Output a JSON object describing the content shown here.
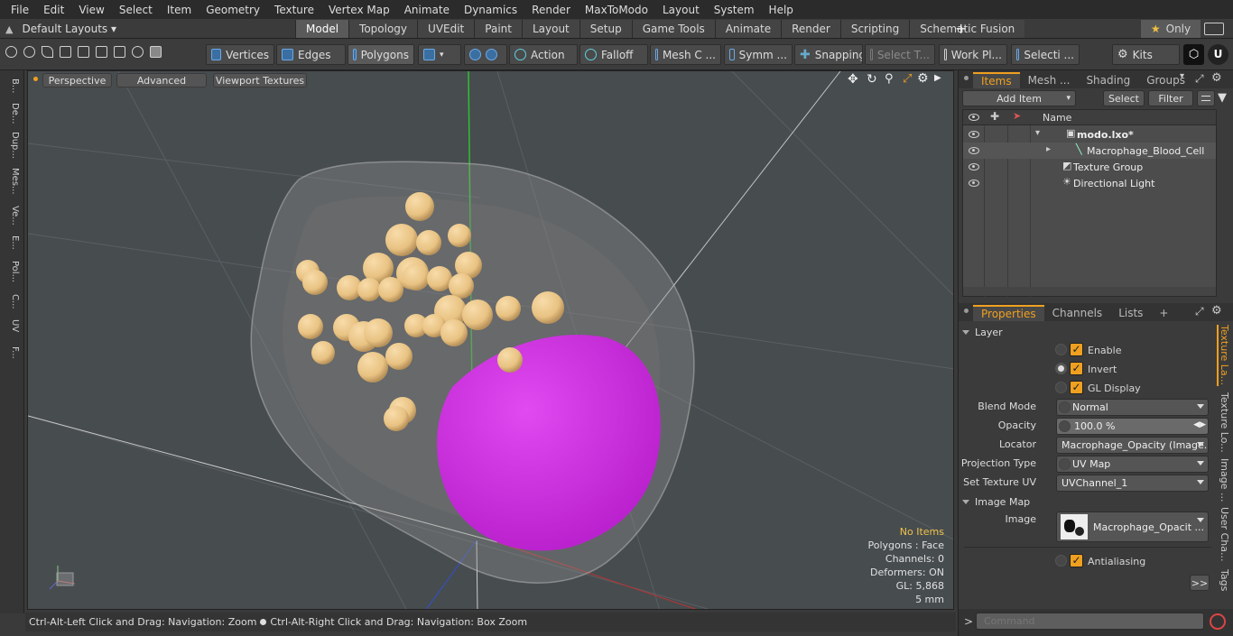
{
  "menu": [
    "File",
    "Edit",
    "View",
    "Select",
    "Item",
    "Geometry",
    "Texture",
    "Vertex Map",
    "Animate",
    "Dynamics",
    "Render",
    "MaxToModo",
    "Layout",
    "System",
    "Help"
  ],
  "layouts_label": "Default Layouts",
  "tabs": [
    "Model",
    "Topology",
    "UVEdit",
    "Paint",
    "Layout",
    "Setup",
    "Game Tools",
    "Animate",
    "Render",
    "Scripting",
    "Schematic Fusion"
  ],
  "tab_add": "+",
  "only_label": "Only",
  "toolbar": {
    "vertices": "Vertices",
    "edges": "Edges",
    "polygons": "Polygons",
    "action": "Action",
    "falloff": "Falloff",
    "mesh": "Mesh C ...",
    "symm": "Symm ...",
    "snapping": "Snapping",
    "select_t": "Select T...",
    "work_plane": "Work Pl...",
    "selecti": "Selecti ...",
    "kits": "Kits"
  },
  "left_tabs": [
    "B...",
    "De...",
    "Dup...",
    "Mes...",
    "Ve...",
    "E...",
    "Pol...",
    "C...",
    "UV",
    "F..."
  ],
  "viewport": {
    "perspective": "Perspective",
    "advanced": "Advanced",
    "viewport_textures": "Viewport Textures",
    "hud": {
      "no_items": "No Items",
      "polygons": "Polygons : Face",
      "channels": "Channels: 0",
      "deformers": "Deformers: ON",
      "gl": "GL: 5,868",
      "units": "5 mm"
    },
    "colors": {
      "nucleus": "#d42ee8",
      "granules": "#e8c282",
      "membrane": "#9a9a9a",
      "background": "#474c4f"
    }
  },
  "status": {
    "left": "Ctrl-Alt-Left Click and Drag: Navigation: Zoom",
    "right": "Ctrl-Alt-Right Click and Drag: Navigation: Box Zoom"
  },
  "items_panel": {
    "tabs": [
      "Items",
      "Mesh ...",
      "Shading",
      "Groups"
    ],
    "add_item": "Add Item",
    "select": "Select",
    "filter": "Filter",
    "col_name": "Name",
    "tree": [
      {
        "label": "modo.lxo*"
      },
      {
        "label": "Macrophage_Blood_Cell"
      },
      {
        "label": "Texture Group"
      },
      {
        "label": "Directional Light"
      }
    ]
  },
  "properties_panel": {
    "tabs": [
      "Properties",
      "Channels",
      "Lists",
      "+"
    ],
    "layer_section": "Layer",
    "enable": "Enable",
    "invert": "Invert",
    "gl_display": "GL Display",
    "blend_mode_label": "Blend Mode",
    "blend_mode": "Normal",
    "opacity_label": "Opacity",
    "opacity": "100.0 %",
    "locator_label": "Locator",
    "locator": "Macrophage_Opacity (Image...",
    "projection_label": "Projection Type",
    "projection": "UV Map",
    "set_uv_label": "Set Texture UV",
    "set_uv": "UVChannel_1",
    "image_map_section": "Image Map",
    "image_label": "Image",
    "image": "Macrophage_Opacit ...",
    "antialiasing": "Antialiasing",
    "more": ">>",
    "side_tabs": [
      "Texture La...",
      "Texture Lo...",
      "Image ...",
      "User Cha...",
      "Tags"
    ]
  },
  "command": {
    "prompt": ">",
    "placeholder": "Command"
  }
}
